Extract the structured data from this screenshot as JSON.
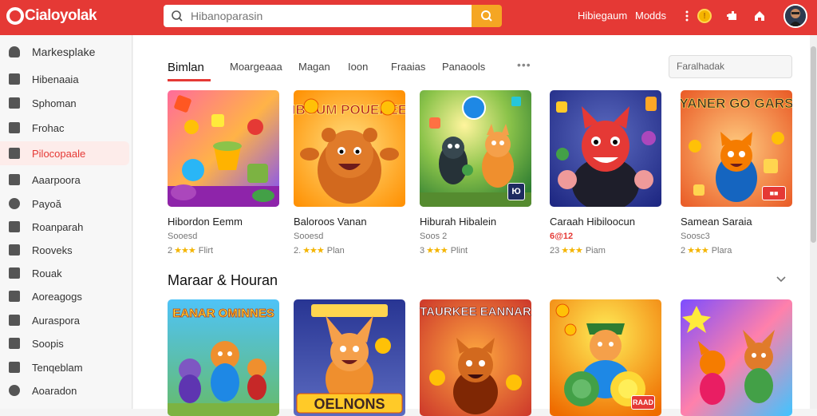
{
  "app": {
    "logo_text": "Cialoyolak"
  },
  "search": {
    "placeholder": "Hibanoparasin"
  },
  "header": {
    "links": [
      "Hibiegaum",
      "Modds"
    ],
    "coin_label": "!"
  },
  "sidebar": {
    "items": [
      {
        "label": "Markesplake",
        "icon": "person-icon"
      },
      {
        "label": "Hibenaaia",
        "icon": "bookmark-icon"
      },
      {
        "label": "Sphoman",
        "icon": "image-icon"
      },
      {
        "label": "Frohac",
        "icon": "camera-icon"
      },
      {
        "label": "Pilocopaale",
        "icon": "folder-icon"
      },
      {
        "label": "Aaarpoora",
        "icon": "document-icon"
      },
      {
        "label": "Payoă",
        "icon": "pin-icon"
      },
      {
        "label": "Roanparah",
        "icon": "envelope-icon"
      },
      {
        "label": "Rooveks",
        "icon": "close-icon"
      },
      {
        "label": "Rouak",
        "icon": "bag-icon"
      },
      {
        "label": "Aoreagogs",
        "icon": "tools-icon"
      },
      {
        "label": "Auraspora",
        "icon": "book-icon"
      },
      {
        "label": "Soopis",
        "icon": "tablet-icon"
      },
      {
        "label": "Tenqeblam",
        "icon": "edit-icon"
      },
      {
        "label": "Aoaradon",
        "icon": "info-icon"
      }
    ]
  },
  "tabs": [
    "Bimlan",
    "Moargeaaa",
    "Magan",
    "Ioon",
    "Fraaias",
    "Panaools"
  ],
  "filter": {
    "placeholder": "Faralhadak"
  },
  "games_row1": [
    {
      "title": "Hibordon Eemm",
      "sub": "Sooesd",
      "rating": "2",
      "stars": "★★★",
      "label": "Flirt",
      "accent": false,
      "badge": ""
    },
    {
      "title": "Baloroos Vanan",
      "sub": "Sooesd",
      "rating": "2.",
      "stars": "★★★",
      "label": "Plan",
      "accent": false,
      "badge": ""
    },
    {
      "title": "Hiburah Hibalein",
      "sub": "Soos 2",
      "rating": "3",
      "stars": "★★★",
      "label": "Plint",
      "accent": false,
      "badge": "Ю"
    },
    {
      "title": "Caraah Hibiloocun",
      "sub": "6@12",
      "rating": "23",
      "stars": "★★★",
      "label": "Piam",
      "accent": true,
      "badge": ""
    },
    {
      "title": "Samean Saraia",
      "sub": "Soosc3",
      "rating": "2",
      "stars": "★★★",
      "label": "Plara",
      "accent": false,
      "badge": ""
    }
  ],
  "thumb_text_row1": [
    "",
    "HIBOUM POUEREEN",
    "",
    "",
    "YANER GO GARS"
  ],
  "section": {
    "title": "Maraar & Houran"
  },
  "thumb_text_row2": [
    "EANAR OMINNES",
    "OELNONS",
    "TAURKEE EANNAR",
    "",
    ""
  ],
  "badges_row2": [
    "",
    "",
    "",
    "RAAD",
    ""
  ],
  "colors": {
    "brand": "#e53935",
    "search_button": "#f5a623",
    "star": "#f4b400"
  }
}
